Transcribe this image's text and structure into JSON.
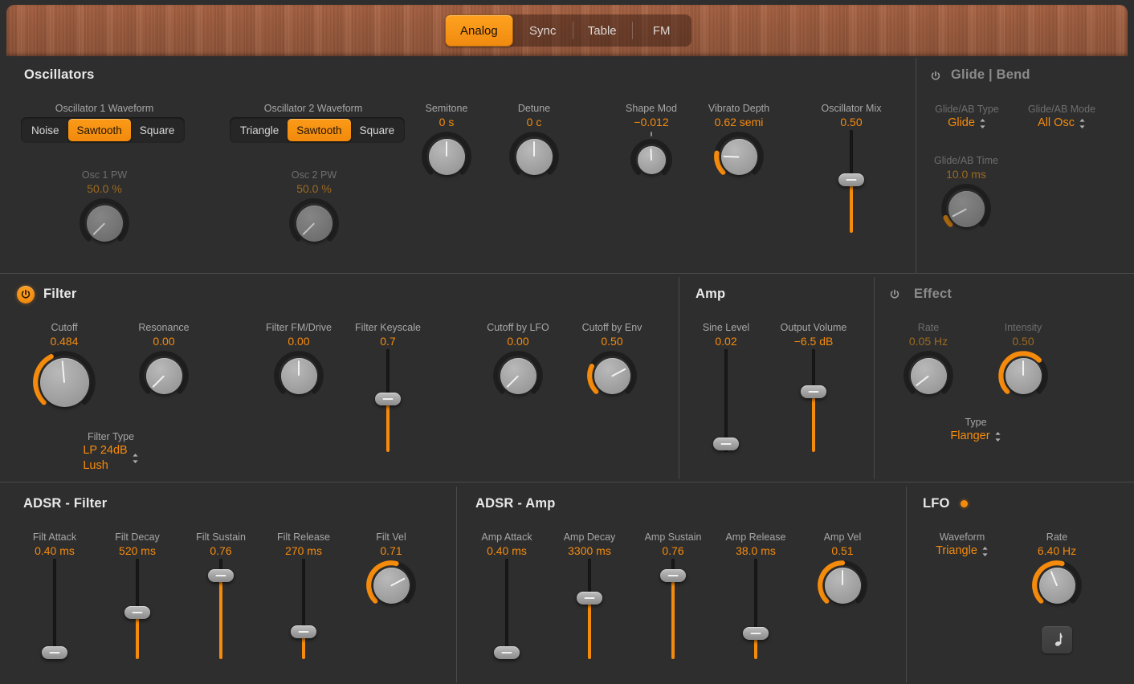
{
  "tabs": [
    {
      "label": "Analog",
      "active": true
    },
    {
      "label": "Sync",
      "active": false
    },
    {
      "label": "Table",
      "active": false
    },
    {
      "label": "FM",
      "active": false
    }
  ],
  "sections": {
    "oscillators": {
      "title": "Oscillators",
      "osc1": {
        "label": "Oscillator 1 Waveform",
        "options": [
          "Noise",
          "Sawtooth",
          "Square"
        ],
        "selected": "Sawtooth",
        "pw_label": "Osc 1 PW",
        "pw_value": "50.0 %"
      },
      "osc2": {
        "label": "Oscillator 2 Waveform",
        "options": [
          "Triangle",
          "Sawtooth",
          "Square"
        ],
        "selected": "Sawtooth",
        "pw_label": "Osc 2 PW",
        "pw_value": "50.0 %"
      },
      "semitone": {
        "label": "Semitone",
        "value": "0 s"
      },
      "detune": {
        "label": "Detune",
        "value": "0 c"
      },
      "shape_mod": {
        "label": "Shape Mod",
        "value": "−0.012"
      },
      "vibrato_depth": {
        "label": "Vibrato Depth",
        "value": "0.62 semi"
      },
      "oscillator_mix": {
        "label": "Oscillator Mix",
        "value": "0.50"
      }
    },
    "glide_bend": {
      "title": "Glide | Bend",
      "power": "off",
      "type": {
        "label": "Glide/AB Type",
        "value": "Glide"
      },
      "mode": {
        "label": "Glide/AB Mode",
        "value": "All Osc"
      },
      "time": {
        "label": "Glide/AB Time",
        "value": "10.0 ms"
      }
    },
    "filter": {
      "title": "Filter",
      "power": "on",
      "cutoff": {
        "label": "Cutoff",
        "value": "0.484"
      },
      "resonance": {
        "label": "Resonance",
        "value": "0.00"
      },
      "fm_drive": {
        "label": "Filter FM/Drive",
        "value": "0.00"
      },
      "keyscale": {
        "label": "Filter Keyscale",
        "value": "0.7"
      },
      "cutoff_by_lfo": {
        "label": "Cutoff by LFO",
        "value": "0.00"
      },
      "cutoff_by_env": {
        "label": "Cutoff by Env",
        "value": "0.50"
      },
      "filter_type": {
        "label": "Filter Type",
        "value_line1": "LP 24dB",
        "value_line2": "Lush"
      }
    },
    "amp": {
      "title": "Amp",
      "sine_level": {
        "label": "Sine Level",
        "value": "0.02"
      },
      "output_volume": {
        "label": "Output Volume",
        "value": "−6.5 dB"
      }
    },
    "effect": {
      "title": "Effect",
      "power": "off",
      "rate": {
        "label": "Rate",
        "value": "0.05 Hz"
      },
      "intensity": {
        "label": "Intensity",
        "value": "0.50"
      },
      "type": {
        "label": "Type",
        "value": "Flanger"
      }
    },
    "adsr_filter": {
      "title": "ADSR - Filter",
      "attack": {
        "label": "Filt Attack",
        "value": "0.40 ms"
      },
      "decay": {
        "label": "Filt Decay",
        "value": "520 ms"
      },
      "sustain": {
        "label": "Filt Sustain",
        "value": "0.76"
      },
      "release": {
        "label": "Filt Release",
        "value": "270 ms"
      },
      "velocity": {
        "label": "Filt Vel",
        "value": "0.71"
      }
    },
    "adsr_amp": {
      "title": "ADSR - Amp",
      "attack": {
        "label": "Amp Attack",
        "value": "0.40 ms"
      },
      "decay": {
        "label": "Amp Decay",
        "value": "3300 ms"
      },
      "sustain": {
        "label": "Amp Sustain",
        "value": "0.76"
      },
      "release": {
        "label": "Amp Release",
        "value": "38.0 ms"
      },
      "velocity": {
        "label": "Amp Vel",
        "value": "0.51"
      }
    },
    "lfo": {
      "title": "LFO",
      "waveform": {
        "label": "Waveform",
        "value": "Triangle"
      },
      "rate": {
        "label": "Rate",
        "value": "6.40 Hz"
      },
      "note_button": "note-icon"
    }
  },
  "colors": {
    "accent": "#f58b0d",
    "panel": "#2e2e2e",
    "wood": "#9d5c3e",
    "label": "#a7a7a7"
  }
}
